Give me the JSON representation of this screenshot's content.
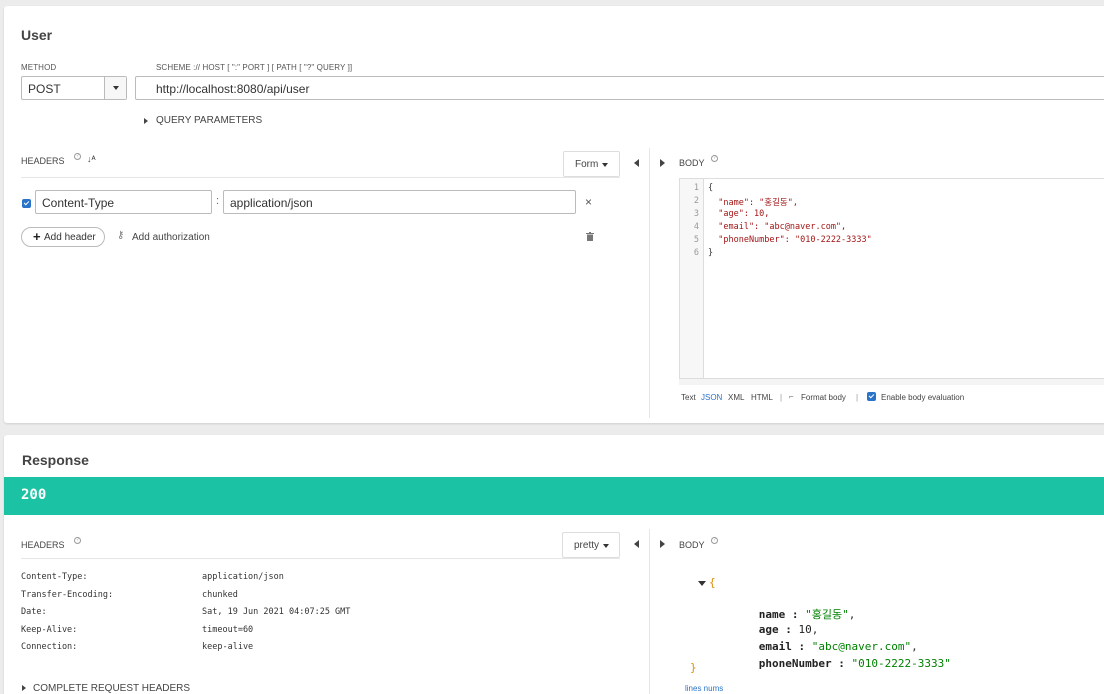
{
  "request": {
    "title": "User",
    "method_label": "METHOD",
    "method": "POST",
    "url_label": "SCHEME :// HOST [ \":\" PORT ] [ PATH [ \"?\" QUERY ]]",
    "url": "http://localhost:8080/api/user",
    "query_params_label": "QUERY PARAMETERS",
    "headers_label": "HEADERS",
    "headers_mode": "Form",
    "headers": [
      {
        "enabled": true,
        "name": "Content-Type",
        "separator": ":",
        "value": "application/json"
      }
    ],
    "add_header_label": "Add header",
    "add_authorization_label": "Add authorization",
    "body_label": "BODY",
    "body_lines": [
      {
        "num": "1",
        "text": "{"
      },
      {
        "num": "2",
        "text": "  \"name\": \"홍길동\","
      },
      {
        "num": "3",
        "text": "  \"age\": 10,"
      },
      {
        "num": "4",
        "text": "  \"email\": \"abc@naver.com\","
      },
      {
        "num": "5",
        "text": "  \"phoneNumber\": \"010-2222-3333\""
      },
      {
        "num": "6",
        "text": "}"
      }
    ],
    "body_formats": [
      "Text",
      "JSON",
      "XML",
      "HTML"
    ],
    "body_format_selected": "JSON",
    "format_body_label": "Format body",
    "enable_eval_label": "Enable body evaluation",
    "enable_eval_checked": true
  },
  "response": {
    "title": "Response",
    "status_code": "200",
    "status_color": "#1bc3a4",
    "headers_label": "HEADERS",
    "headers_mode": "pretty",
    "headers": [
      {
        "key": "Content-Type:",
        "value": "application/json"
      },
      {
        "key": "Transfer-Encoding:",
        "value": "chunked"
      },
      {
        "key": "Date:",
        "value": "Sat, 19 Jun 2021 04:07:25 GMT"
      },
      {
        "key": "Keep-Alive:",
        "value": "timeout=60"
      },
      {
        "key": "Connection:",
        "value": "keep-alive"
      }
    ],
    "complete_request_headers_label": "COMPLETE REQUEST HEADERS",
    "body_label": "BODY",
    "body_json": {
      "open": "{",
      "close": "}",
      "fields": [
        {
          "key": "name",
          "value": "\"홍길동\"",
          "type": "string",
          "suffix": ","
        },
        {
          "key": "age",
          "value": "10",
          "type": "number",
          "suffix": ","
        },
        {
          "key": "email",
          "value": "\"abc@naver.com\"",
          "type": "string",
          "suffix": ","
        },
        {
          "key": "phoneNumber",
          "value": "\"010-2222-3333\"",
          "type": "string",
          "suffix": ""
        }
      ]
    },
    "lines_nums_label": "lines nums"
  },
  "icons": {
    "sort": "sort-alpha-icon",
    "help": "help-icon",
    "remove": "close-icon",
    "trash": "trash-icon",
    "plus": "plus-icon",
    "key": "key-icon",
    "wand": "format-wand-icon"
  }
}
